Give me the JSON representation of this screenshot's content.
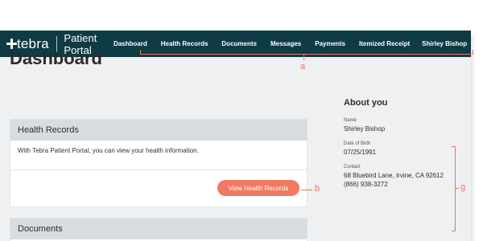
{
  "nav": {
    "brand": "tebra",
    "subtitle": "Patient Portal",
    "items": [
      "Dashboard",
      "Health Records",
      "Documents",
      "Messages",
      "Payments",
      "Itemized Receipt"
    ],
    "user": "Shirley Bishop"
  },
  "page": {
    "title": "Dashboard"
  },
  "health_card": {
    "title": "Health Records",
    "body": "With Tebra Patient Portal, you can view your health information.",
    "button": "View Health Records"
  },
  "documents_card": {
    "title": "Documents"
  },
  "about": {
    "title": "About you",
    "name_label": "Name",
    "name": "Shirley Bishop",
    "dob_label": "Date of Birth",
    "dob": "07/25/1991",
    "contact_label": "Contact",
    "address": "68 Bluebird Lane, Irvine, CA 92612",
    "phone": "(866) 938-3272"
  },
  "annotations": {
    "a": "a",
    "b": "b",
    "g": "g"
  },
  "colors": {
    "nav_bg": "#0f3b45",
    "accent": "#f07a62",
    "annotation": "#e8795f"
  }
}
